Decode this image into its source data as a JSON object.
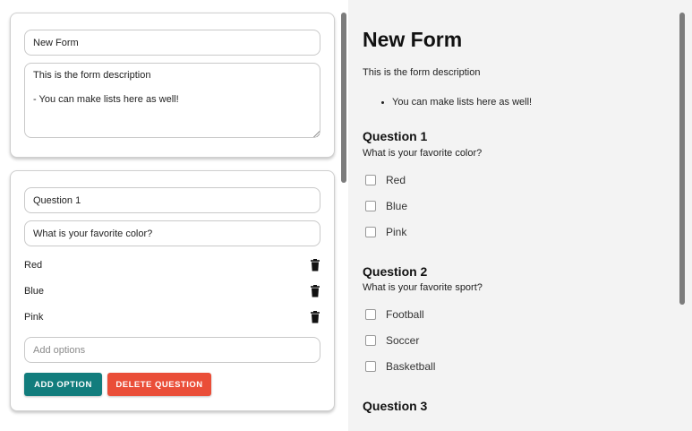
{
  "editor": {
    "form": {
      "title_value": "New Form",
      "description_value": "This is the form description\n\n- You can make lists here as well!"
    },
    "question": {
      "title_value": "Question 1",
      "prompt_value": "What is your favorite color?",
      "options": [
        {
          "label": "Red"
        },
        {
          "label": "Blue"
        },
        {
          "label": "Pink"
        }
      ],
      "add_option_placeholder": "Add options",
      "add_option_label": "ADD OPTION",
      "delete_question_label": "DELETE QUESTION"
    }
  },
  "preview": {
    "title": "New Form",
    "description": "This is the form description",
    "bullet": "You can make lists here as well!",
    "questions": [
      {
        "heading": "Question 1",
        "text": "What is your favorite color?",
        "options": [
          "Red",
          "Blue",
          "Pink"
        ]
      },
      {
        "heading": "Question 2",
        "text": "What is your favorite sport?",
        "options": [
          "Football",
          "Soccer",
          "Basketball"
        ]
      },
      {
        "heading": "Question 3"
      }
    ]
  },
  "colors": {
    "add_button": "#127d7d",
    "delete_button": "#ea4e38",
    "preview_bg": "#f3f3f3"
  }
}
